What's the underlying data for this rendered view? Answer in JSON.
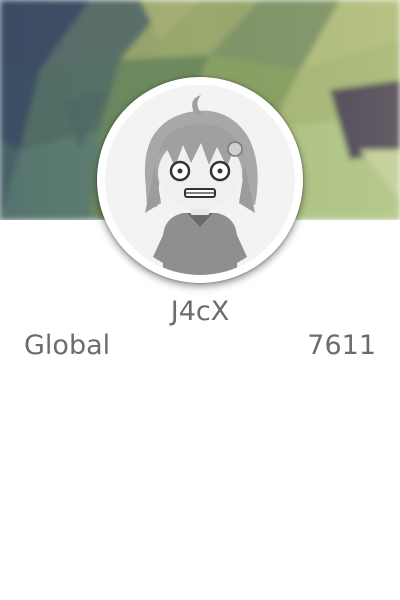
{
  "profile": {
    "username": "J4cX"
  },
  "rank": {
    "label": "Global",
    "value": "7611"
  }
}
